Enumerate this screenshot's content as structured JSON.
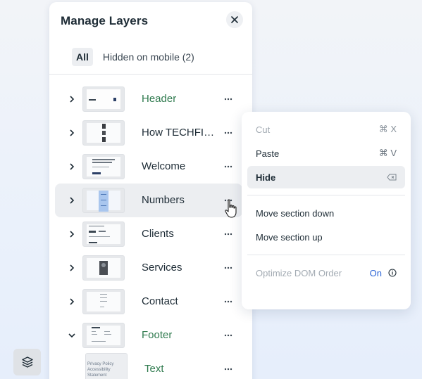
{
  "panel": {
    "title": "Manage Layers",
    "tabs": [
      {
        "label": "All",
        "active": true
      },
      {
        "label": "Hidden on mobile (2)",
        "active": false
      }
    ]
  },
  "layers": [
    {
      "label": "Header",
      "expanded": false,
      "highlight": "green"
    },
    {
      "label": "How TECHFIT...",
      "expanded": false
    },
    {
      "label": "Welcome",
      "expanded": false
    },
    {
      "label": "Numbers",
      "expanded": false,
      "hovered": true
    },
    {
      "label": "Clients",
      "expanded": false
    },
    {
      "label": "Services",
      "expanded": false
    },
    {
      "label": "Contact",
      "expanded": false
    },
    {
      "label": "Footer",
      "expanded": true,
      "highlight": "green"
    },
    {
      "label": "Text",
      "child": true,
      "highlight": "green",
      "thumb_text": "Privacy Policy Accessibility Statement"
    }
  ],
  "context_menu": {
    "items": [
      {
        "label": "Cut",
        "shortcut": "⌘ X",
        "disabled": true
      },
      {
        "label": "Paste",
        "shortcut": "⌘ V"
      },
      {
        "label": "Hide",
        "shortcut_icon": "backspace-icon",
        "active": true
      },
      {
        "label": "Move section down"
      },
      {
        "label": "Move section up"
      },
      {
        "label": "Optimize DOM Order",
        "value": "On",
        "info_icon": "info-icon",
        "disabled": true
      }
    ]
  },
  "colors": {
    "green_label": "#2f7a4e",
    "accent_blue": "#2a63d6",
    "hover_bg": "#eceef1"
  }
}
